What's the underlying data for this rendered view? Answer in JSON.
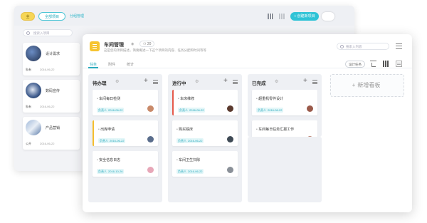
{
  "background_window": {
    "pill_yellow": "全",
    "pill_outline": "全部项目",
    "link": "分组管理",
    "new_button": "+ 创建新项目",
    "search_placeholder": "搜索入项目",
    "cards": [
      {
        "title": "设计需求",
        "owner": "私有",
        "date": "2016-06-22"
      },
      {
        "title": "数码宣传",
        "owner": "私有",
        "date": "2016-06-22"
      },
      {
        "title": "产品营销",
        "owner": "公开",
        "date": "2016-06-22"
      }
    ]
  },
  "project": {
    "title": "车间管理",
    "member_count": "20",
    "description": "这是您的项目描述，简要概述一下这个项目的内容、任务分配和时间等等",
    "search_placeholder": "搜索入内容"
  },
  "tabs": [
    {
      "label": "任务",
      "active": true
    },
    {
      "label": "附件",
      "active": false
    },
    {
      "label": "统计",
      "active": false
    }
  ],
  "toolbar": {
    "settings_label": "设计任务"
  },
  "columns": [
    {
      "title": "待办理",
      "tasks": [
        {
          "title": "车间每日检测",
          "assignee": "负责人",
          "date": "2016-06-22",
          "accent": "none",
          "avatar_color": "#c98a6a"
        },
        {
          "title": "出库申请",
          "assignee": "负责人",
          "date": "2016-06-22",
          "accent": "yellow",
          "avatar_color": "#5a6d8c"
        },
        {
          "title": "安全信息日志",
          "assignee": "负责人",
          "date": "2016-10-26",
          "accent": "none",
          "avatar_color": "#e7a7b8"
        }
      ]
    },
    {
      "title": "进行中",
      "tasks": [
        {
          "title": "车床维修",
          "assignee": "负责人",
          "date": "2016-06-22",
          "accent": "red",
          "avatar_color": "#5b3a2e"
        },
        {
          "title": "购买铣床",
          "assignee": "负责人",
          "date": "2016-06-22",
          "accent": "none",
          "avatar_color": "#3f4a55"
        },
        {
          "title": "车间卫生扫除",
          "assignee": "负责人",
          "date": "2016-06-22",
          "accent": "none",
          "avatar_color": "#8a9098"
        }
      ]
    },
    {
      "title": "已完成",
      "tasks": [
        {
          "title": "超重机零件设计",
          "assignee": "负责人",
          "date": "2016-06-22",
          "accent": "none",
          "avatar_color": "#9a5a4a"
        },
        {
          "title": "车间每日任务汇报工作",
          "assignee": "负责人",
          "date": "2016-06-22",
          "accent": "none",
          "avatar_color": "#b77b6a"
        }
      ]
    }
  ],
  "new_board_label": "新增看板",
  "colors": {
    "accent": "#2fc3d6",
    "yellow": "#f6c431",
    "red": "#e6594a"
  }
}
